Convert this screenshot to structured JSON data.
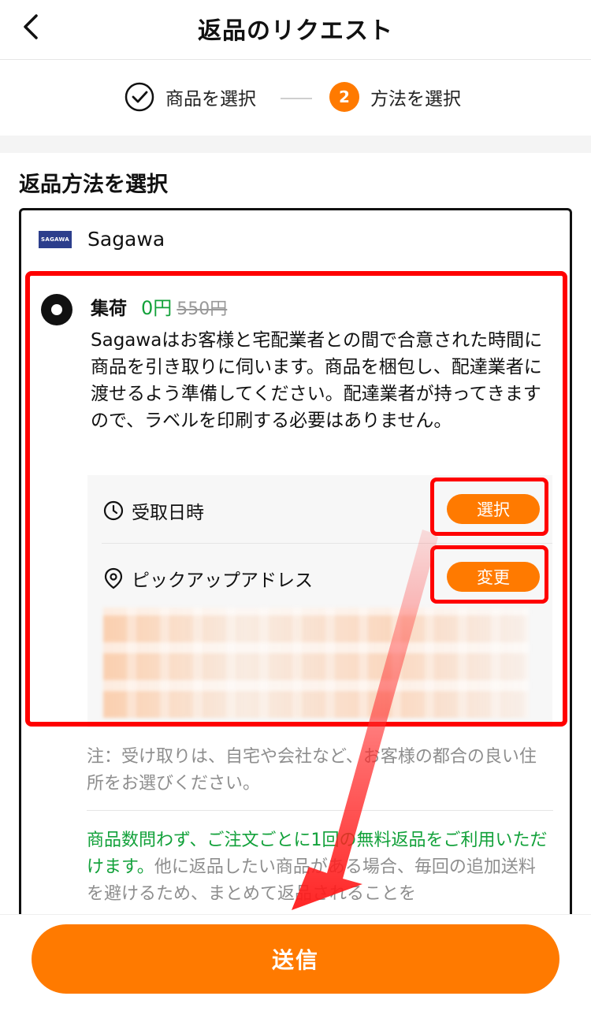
{
  "header": {
    "title": "返品のリクエスト"
  },
  "steps": [
    {
      "label": "商品を選択",
      "state": "done"
    },
    {
      "number": "2",
      "label": "方法を選択",
      "state": "current"
    }
  ],
  "section_title": "返品方法を選択",
  "carrier": {
    "logo_text": "SAGAWA",
    "name": "Sagawa"
  },
  "option": {
    "name": "集荷",
    "price": "0円",
    "old_price": "550円",
    "description": "Sagawaはお客様と宅配業者との間で合意された時間に商品を引き取りに伺います。商品を梱包し、配達業者に渡せるよう準備してください。配達業者が持ってきますので、ラベルを印刷する必要はありません。"
  },
  "pickup": {
    "date_label": "受取日時",
    "date_button": "選択",
    "address_label": "ピックアップアドレス",
    "address_button": "変更"
  },
  "note": "注：受け取りは、自宅や会社など、お客様の都合の良い住所をお選びください。",
  "promo": {
    "highlight": "商品数問わず、ご注文ごとに1回の無料返品をご利用いただけます。",
    "rest": "他に返品したい商品がある場合、毎回の追加送料を避けるため、まとめて返品されることを"
  },
  "submit_label": "送信",
  "colors": {
    "accent": "#ff7a00",
    "price_green": "#12a13a",
    "annotation_red": "#ff0000"
  }
}
